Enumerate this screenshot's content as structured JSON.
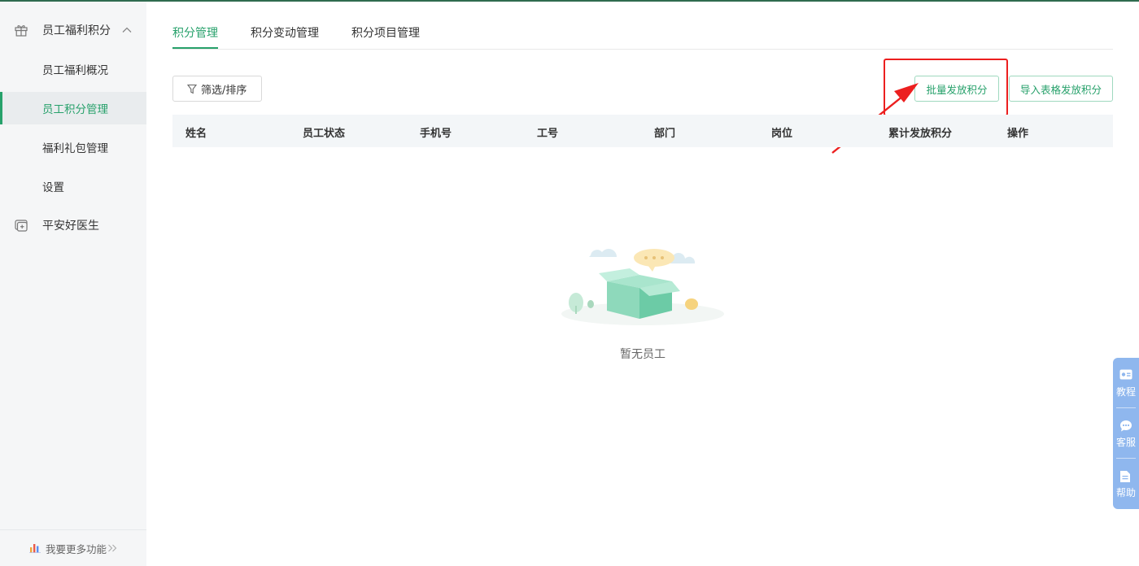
{
  "sidebar": {
    "group1_label": "员工福利积分",
    "items": [
      {
        "label": "员工福利概况"
      },
      {
        "label": "员工积分管理"
      },
      {
        "label": "福利礼包管理"
      },
      {
        "label": "设置"
      }
    ],
    "group2_label": "平安好医生",
    "footer_label": "我要更多功能",
    "group1_icon": "gift-icon",
    "group2_icon": "doctor-box-icon",
    "active_item": "员工积分管理"
  },
  "tabs": [
    {
      "label": "积分管理"
    },
    {
      "label": "积分变动管理"
    },
    {
      "label": "积分项目管理"
    }
  ],
  "toolbar": {
    "filter_label": "筛选/排序",
    "batch_label": "批量发放积分",
    "import_label": "导入表格发放积分"
  },
  "table": {
    "columns": [
      "姓名",
      "员工状态",
      "手机号",
      "工号",
      "部门",
      "岗位",
      "累计发放积分",
      "操作"
    ],
    "empty_text": "暂无员工"
  },
  "float_panel": {
    "items": [
      {
        "label": "教程",
        "icon": "tutorial-icon"
      },
      {
        "label": "客服",
        "icon": "chat-icon"
      },
      {
        "label": "帮助",
        "icon": "document-icon"
      }
    ]
  },
  "colors": {
    "accent": "#27a16b",
    "annotation": "#ec1f1f",
    "float_panel": "#8fb7ee"
  }
}
